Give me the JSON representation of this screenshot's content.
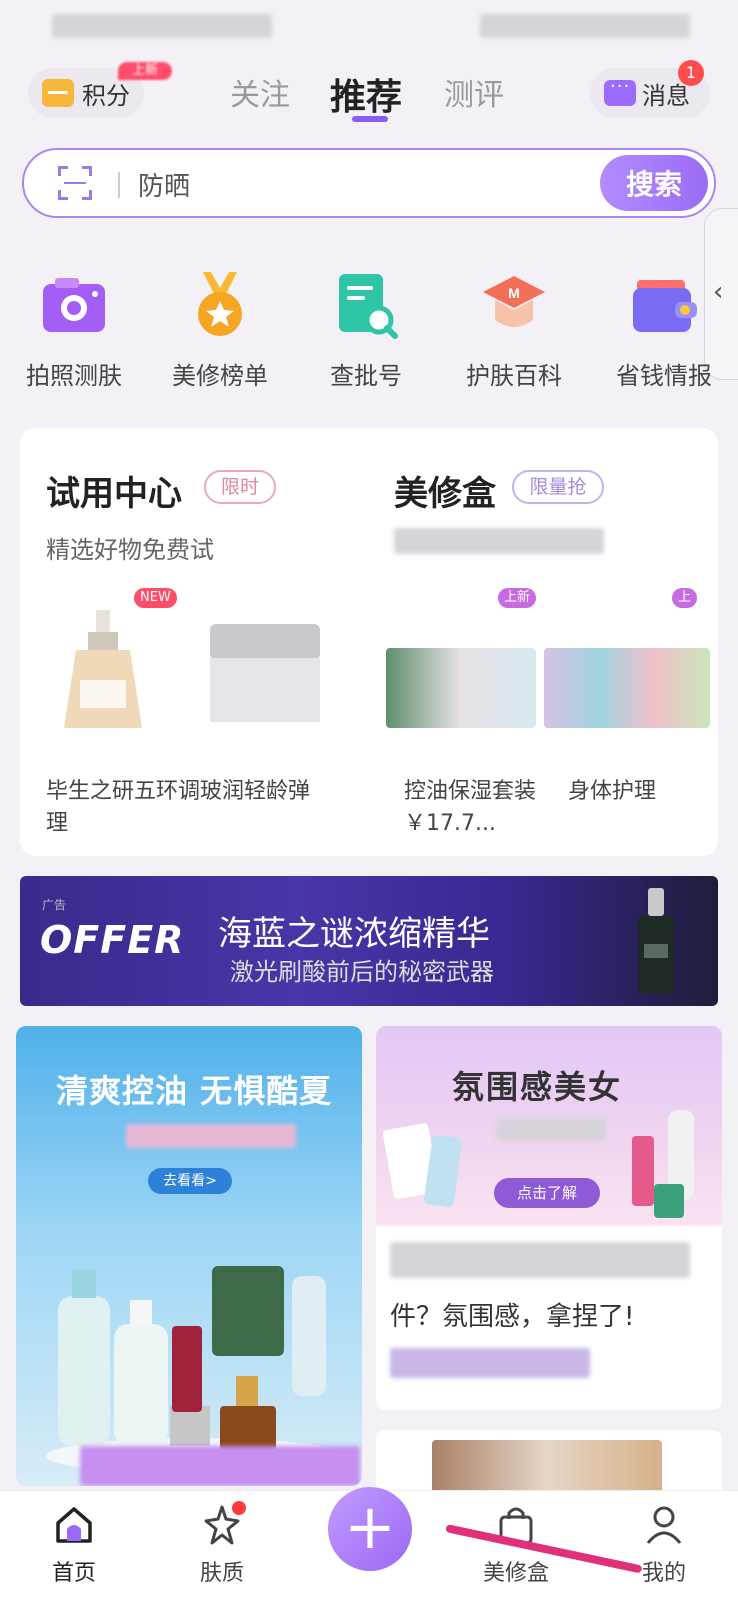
{
  "top_nav": {
    "points_label": "积分",
    "points_badge": "上新",
    "tabs": [
      {
        "label": "关注"
      },
      {
        "label": "推荐"
      },
      {
        "label": "测评"
      }
    ],
    "messages_label": "消息",
    "messages_badge": "1"
  },
  "search": {
    "placeholder": "防晒",
    "button_label": "搜索"
  },
  "tools": [
    {
      "label": "拍照测肤",
      "icon": "camera-icon"
    },
    {
      "label": "美修榜单",
      "icon": "medal-icon"
    },
    {
      "label": "查批号",
      "icon": "batch-search-icon"
    },
    {
      "label": "护肤百科",
      "icon": "graduation-cap-icon"
    },
    {
      "label": "省钱情报",
      "icon": "wallet-icon"
    }
  ],
  "trial_card": {
    "left_title": "试用中心",
    "left_tag": "限时",
    "left_subtitle": "精选好物免费试",
    "right_title": "美修盒",
    "right_tag": "限量抢",
    "products": [
      {
        "name": "毕生之研五环调理",
        "badge": "NEW"
      },
      {
        "name": "玻润轻龄弹",
        "badge": ""
      },
      {
        "name": "控油保湿套装 ￥17.7...",
        "badge": "上新"
      },
      {
        "name": "身体护理",
        "badge": "上新"
      }
    ]
  },
  "ad_banner": {
    "tag": "广告",
    "logo": "OFFER",
    "title": "海蓝之谜浓缩精华",
    "subtitle": "激光刷酸前后的秘密武器"
  },
  "feed": {
    "left_title": "清爽控油 无惧酷夏",
    "left_button": "去看看>",
    "right_title": "氛围感美女",
    "right_button": "点击了解",
    "right_text": "件？氛围感，拿捏了!"
  },
  "bottom_nav": [
    {
      "label": "首页",
      "icon": "home-icon"
    },
    {
      "label": "肤质",
      "icon": "skin-sparkle-icon"
    },
    {
      "label": "美修盒",
      "icon": "shopping-bag-icon"
    },
    {
      "label": "我的",
      "icon": "person-icon"
    }
  ],
  "colors": {
    "accent": "#9a6cf5",
    "background": "#f3f1f6",
    "badge_red": "#ff4d4f"
  }
}
